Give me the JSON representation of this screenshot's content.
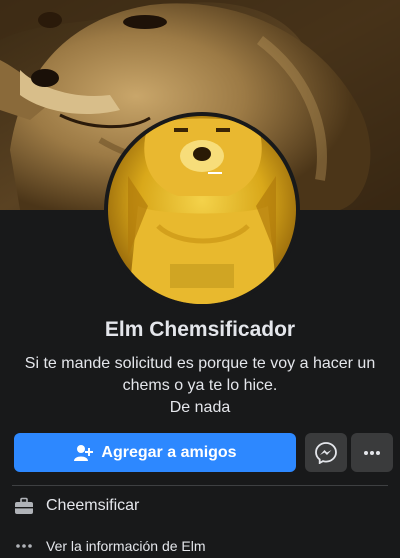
{
  "profile": {
    "name": "Elm Chemsificador",
    "bio_lines": [
      "Si te mande solicitud es porque te voy a hacer un",
      "chems o ya te lo hice.",
      "De nada"
    ]
  },
  "actions": {
    "add_friend_label": "Agregar a amigos",
    "messenger_icon": "messenger-icon",
    "more_icon": "more-horizontal-icon"
  },
  "info": {
    "work_label": "Cheemsificar",
    "work_icon": "briefcase-icon",
    "see_info_label": "Ver la información de Elm",
    "see_info_icon": "ellipsis-icon"
  },
  "colors": {
    "background": "#18191a",
    "primary_button": "#2d88ff",
    "secondary_button": "#3a3b3c",
    "text": "#e4e6eb"
  }
}
